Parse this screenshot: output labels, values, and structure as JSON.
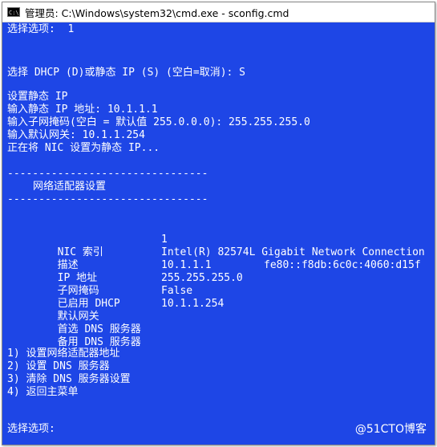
{
  "window": {
    "title": "管理员: C:\\Windows\\system32\\cmd.exe - sconfig.cmd",
    "icon": "cmd-app-icon",
    "icon_text": "C:\\",
    "background_color": "#1e46e6",
    "text_color": "#ffffff"
  },
  "console": {
    "line_select_top": "选择选项:  1",
    "line_dhcp_prompt": "选择 DHCP (D)或静态 IP (S) (空白=取消): S",
    "line_set_static": "设置静态 IP",
    "line_ip_input": "输入静态 IP 地址: 10.1.1.1",
    "line_mask_input": "输入子网掩码(空白 = 默认值 255.0.0.0): 255.255.255.0",
    "line_gateway_input": "输入默认网关: 10.1.1.254",
    "line_setting_nic": "正在将 NIC 设置为静态 IP...",
    "separator_top": "--------------------------------",
    "section_title": "网络适配器设置",
    "separator_bottom": "--------------------------------",
    "nic": [
      {
        "label": "NIC 索引",
        "value": "1",
        "extra": ""
      },
      {
        "label": "描述",
        "value": "Intel(R) 82574L Gigabit Network Connection",
        "extra": ""
      },
      {
        "label": "IP 地址",
        "value": "10.1.1.1",
        "extra": "fe80::f8db:6c0c:4060:d15f"
      },
      {
        "label": "子网掩码",
        "value": "255.255.255.0",
        "extra": ""
      },
      {
        "label": "已启用 DHCP",
        "value": "False",
        "extra": ""
      },
      {
        "label": "默认网关",
        "value": "10.1.1.254",
        "extra": ""
      },
      {
        "label": "首选 DNS 服务器",
        "value": "",
        "extra": ""
      },
      {
        "label": "备用 DNS 服务器",
        "value": "",
        "extra": ""
      }
    ],
    "menu": [
      "1) 设置网络适配器地址",
      "2) 设置 DNS 服务器",
      "3) 清除 DNS 服务器设置",
      "4) 返回主菜单"
    ],
    "line_select_bottom": "选择选项:"
  },
  "watermark": "@51CTO博客"
}
